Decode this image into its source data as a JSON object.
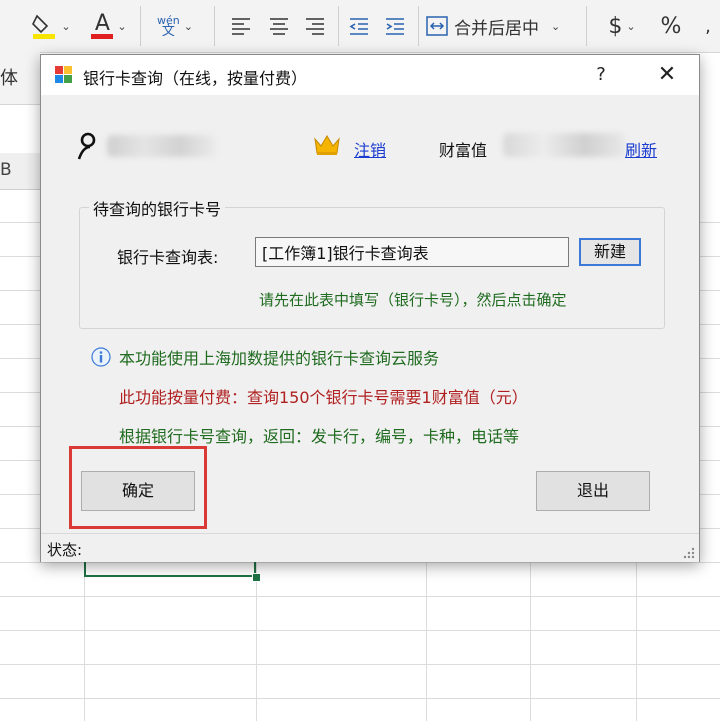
{
  "ribbon": {
    "fill_icon": "paint-bucket-icon",
    "font_color_glyph": "A",
    "phonetic_top": "wén",
    "phonetic_bottom": "文",
    "align_icons": [
      "align-left-icon",
      "align-center-icon",
      "align-right-icon",
      "indent-decrease-icon",
      "indent-increase-icon"
    ],
    "merge_label": "合并后居中",
    "currency_glyph": "$",
    "percent_glyph": "%",
    "colors": {
      "fill_yellow": "#f7e400",
      "font_red": "#e02020"
    }
  },
  "sheet": {
    "font_label": "体",
    "column_label": "B",
    "selection_color": "#1e7145"
  },
  "dialog": {
    "title": "银行卡查询（在线，按量付费）",
    "help_label": "?",
    "close_label": "✕",
    "user": {
      "logout_label": "注销",
      "wealth_label": "财富值",
      "refresh_label": "刷新"
    },
    "group": {
      "legend": "待查询的银行卡号",
      "table_label": "银行卡查询表:",
      "table_value": "[工作簿1]银行卡查询表",
      "new_label": "新建",
      "hint": "请先在此表中填写（银行卡号），然后点击确定"
    },
    "info": {
      "service": "本功能使用上海加数提供的银行卡查询云服务",
      "fee": "此功能按量付费：查询150个银行卡号需要1财富值（元）",
      "returns": "根据银行卡号查询，返回：发卡行，编号，卡种，电话等"
    },
    "buttons": {
      "ok": "确定",
      "exit": "退出"
    },
    "status_label": "状态:",
    "colors": {
      "link": "#1a3ccf",
      "hint_green": "#1f6b1f",
      "fee_red": "#b02020",
      "highlight_red": "#d93a35"
    }
  }
}
